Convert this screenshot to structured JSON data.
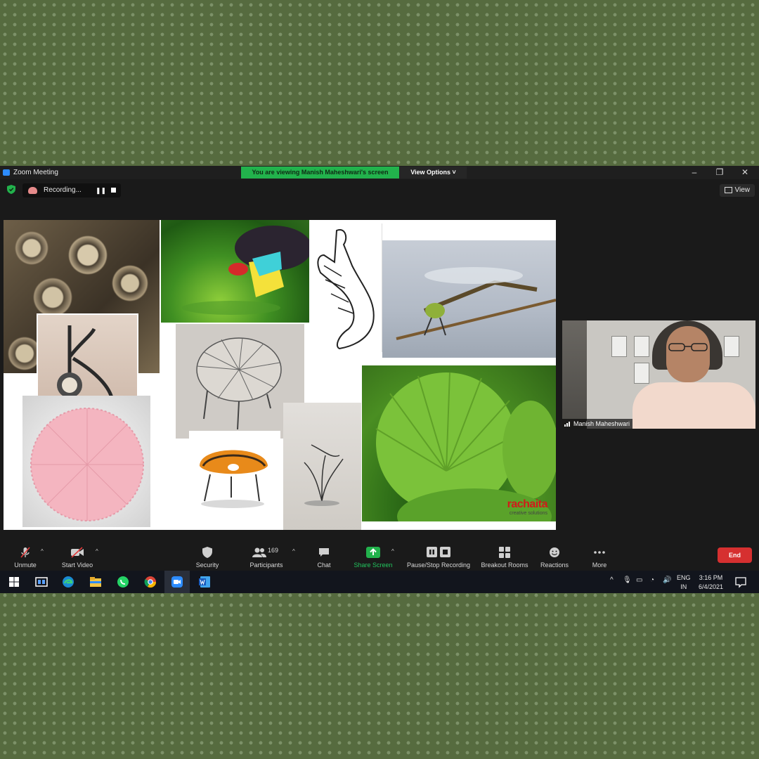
{
  "window": {
    "app_title": "Zoom Meeting",
    "viewing_banner": "You are viewing Manish Maheshwari's screen",
    "view_options": "View Options ˅"
  },
  "status": {
    "recording_label": "Recording...",
    "view_label": "View"
  },
  "shared_screen": {
    "logo_text": "rachaita",
    "logo_subtext": "creative solutions"
  },
  "video": {
    "participant_name": "Manish Maheshwari"
  },
  "toolbar": {
    "unmute": "Unmute",
    "start_video": "Start Video",
    "security": "Security",
    "participants": "Participants",
    "participants_count": "169",
    "chat": "Chat",
    "share_screen": "Share Screen",
    "pause_stop_recording": "Pause/Stop Recording",
    "breakout_rooms": "Breakout Rooms",
    "reactions": "Reactions",
    "more": "More",
    "end": "End"
  },
  "taskbar": {
    "lang_top": "ENG",
    "lang_bottom": "IN",
    "time": "3:16 PM",
    "date": "6/4/2021"
  },
  "colors": {
    "share_green": "#22b24c",
    "end_red": "#d63030",
    "zoom_blue": "#2d8cff"
  }
}
